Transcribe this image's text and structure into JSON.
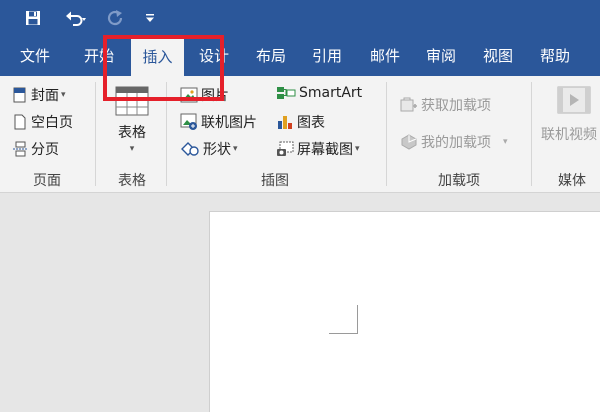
{
  "tabs": [
    "文件",
    "开始",
    "插入",
    "设计",
    "布局",
    "引用",
    "邮件",
    "审阅",
    "视图",
    "帮助"
  ],
  "active_tab": "插入",
  "groups": {
    "pages": {
      "label": "页面",
      "cover": "封面",
      "blank": "空白页",
      "break": "分页"
    },
    "tables": {
      "label": "表格",
      "table": "表格"
    },
    "illustrations": {
      "label": "插图",
      "picture": "图片",
      "online_picture": "联机图片",
      "shapes": "形状",
      "smartart": "SmartArt",
      "chart": "图表",
      "screenshot": "屏幕截图"
    },
    "addins": {
      "label": "加载项",
      "get": "获取加载项",
      "my": "我的加载项"
    },
    "media": {
      "label": "媒体",
      "online_video": "联机视频"
    }
  },
  "colors": {
    "accent": "#2b579a",
    "highlight": "#e5202a",
    "ribbon": "#f3f3f3"
  },
  "icons": [
    "save-icon",
    "undo-icon",
    "redo-icon",
    "customize-icon"
  ]
}
